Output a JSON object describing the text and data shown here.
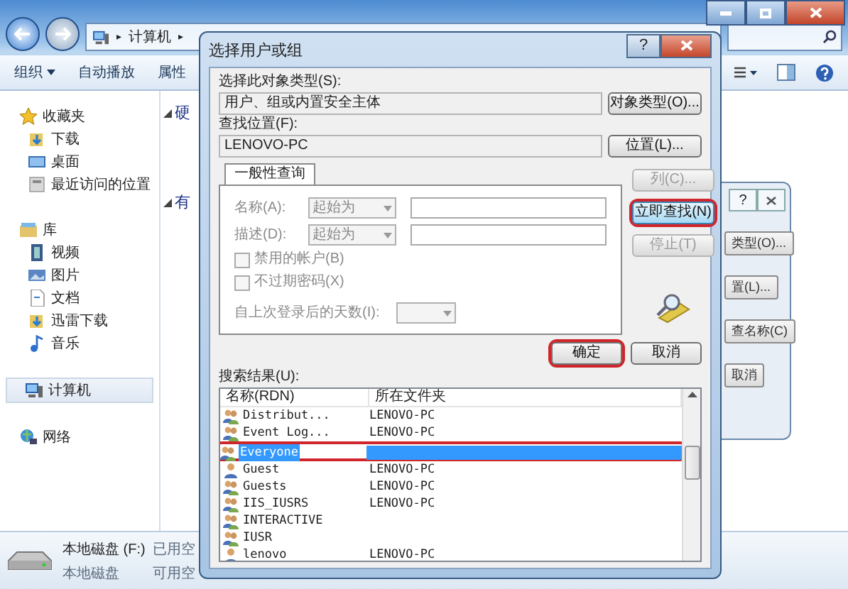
{
  "explorer": {
    "address_path": [
      "计算机"
    ],
    "address_separator": "▸",
    "toolbar": [
      "组织",
      "自动播放",
      "属性"
    ],
    "sidebar": [
      {
        "label": "收藏夹",
        "kind": "star",
        "children": [
          {
            "label": "下载",
            "kind": "download"
          },
          {
            "label": "桌面",
            "kind": "desktop"
          },
          {
            "label": "最近访问的位置",
            "kind": "recent"
          }
        ]
      },
      {
        "label": "库",
        "kind": "library",
        "children": [
          {
            "label": "视频",
            "kind": "video"
          },
          {
            "label": "图片",
            "kind": "picture"
          },
          {
            "label": "文档",
            "kind": "document"
          },
          {
            "label": "迅雷下载",
            "kind": "download"
          },
          {
            "label": "音乐",
            "kind": "music"
          }
        ]
      },
      {
        "label": "计算机",
        "kind": "computer",
        "selected": true
      },
      {
        "label": "网络",
        "kind": "network",
        "selected": false
      }
    ],
    "content_groups": [
      "硬",
      "有"
    ],
    "details": {
      "title": "本地磁盘 (F:)",
      "subtitle": "本地磁盘",
      "field_1": "已用空",
      "field_2": "可用空"
    }
  },
  "back_dialog": {
    "help_button": "?",
    "buttons": [
      "类型(O)...",
      "置(L)...",
      "查名称(C)",
      "取消"
    ]
  },
  "dialog": {
    "title": "选择用户或组",
    "help_button": "?",
    "object_type": {
      "label": "选择此对象类型(S):",
      "value": "用户、组或内置安全主体",
      "button": "对象类型(O)..."
    },
    "location": {
      "label": "查找位置(F):",
      "value": "LENOVO-PC",
      "button": "位置(L)..."
    },
    "tab": {
      "label": "一般性查询",
      "selected": true
    },
    "query_rows": [
      {
        "label": "名称(A):",
        "mode": "起始为"
      },
      {
        "label": "描述(D):",
        "mode": "起始为"
      }
    ],
    "checkboxes": [
      {
        "label": "禁用的帐户(B)",
        "checked": false
      },
      {
        "label": "不过期密码(X)",
        "checked": false
      }
    ],
    "days_label": "自上次登录后的天数(I):",
    "side_buttons": [
      {
        "label": "列(C)...",
        "disabled": true,
        "focused": false,
        "circled": false
      },
      {
        "label": "立即查找(N)",
        "disabled": false,
        "focused": true,
        "circled": true
      },
      {
        "label": "停止(T)",
        "disabled": true,
        "focused": false,
        "circled": false
      }
    ],
    "ok": {
      "label": "确定",
      "circled": true
    },
    "cancel": {
      "label": "取消",
      "circled": false
    },
    "results_label": "搜索结果(U):",
    "columns": [
      "名称(RDN)",
      "所在文件夹"
    ],
    "rows": [
      {
        "name": "Distribut...",
        "folder": "LENOVO-PC",
        "kind": "group",
        "selected": false,
        "circled": false
      },
      {
        "name": "Event Log...",
        "folder": "LENOVO-PC",
        "kind": "group",
        "selected": false,
        "circled": false
      },
      {
        "name": "Everyone",
        "kind": "group",
        "selected": true,
        "circled": true
      },
      {
        "name": "Guest",
        "folder": "LENOVO-PC",
        "kind": "user",
        "selected": false,
        "circled": false
      },
      {
        "name": "Guests",
        "folder": "LENOVO-PC",
        "kind": "group",
        "selected": false,
        "circled": false
      },
      {
        "name": "IIS_IUSRS",
        "folder": "LENOVO-PC",
        "kind": "group",
        "selected": false,
        "circled": false
      },
      {
        "name": "INTERACTIVE",
        "kind": "group",
        "selected": false,
        "circled": false
      },
      {
        "name": "IUSR",
        "kind": "group",
        "selected": false,
        "circled": false
      },
      {
        "name": "lenovo",
        "folder": "LENOVO-PC",
        "kind": "user",
        "selected": false,
        "circled": false
      }
    ]
  }
}
